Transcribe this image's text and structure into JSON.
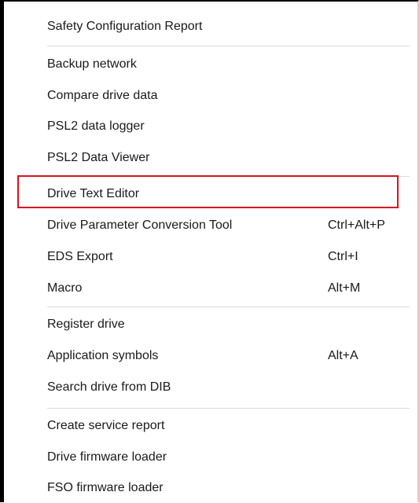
{
  "menu": {
    "items": [
      {
        "label": "Safety Configuration Report",
        "shortcut": ""
      },
      {
        "label": "Backup network",
        "shortcut": ""
      },
      {
        "label": "Compare drive data",
        "shortcut": ""
      },
      {
        "label": "PSL2 data logger",
        "shortcut": ""
      },
      {
        "label": "PSL2 Data Viewer",
        "shortcut": ""
      },
      {
        "label": "Drive Text Editor",
        "shortcut": ""
      },
      {
        "label": "Drive Parameter Conversion Tool",
        "shortcut": "Ctrl+Alt+P"
      },
      {
        "label": "EDS Export",
        "shortcut": "Ctrl+I"
      },
      {
        "label": "Macro",
        "shortcut": "Alt+M"
      },
      {
        "label": "Register drive",
        "shortcut": ""
      },
      {
        "label": "Application symbols",
        "shortcut": "Alt+A"
      },
      {
        "label": "Search drive from DIB",
        "shortcut": ""
      },
      {
        "label": "Create service report",
        "shortcut": ""
      },
      {
        "label": "Drive firmware loader",
        "shortcut": ""
      },
      {
        "label": "FSO firmware loader",
        "shortcut": ""
      }
    ]
  },
  "colors": {
    "highlight_border": "#d9121f",
    "separator": "#dcdcdc",
    "text": "#1a1a1a"
  }
}
